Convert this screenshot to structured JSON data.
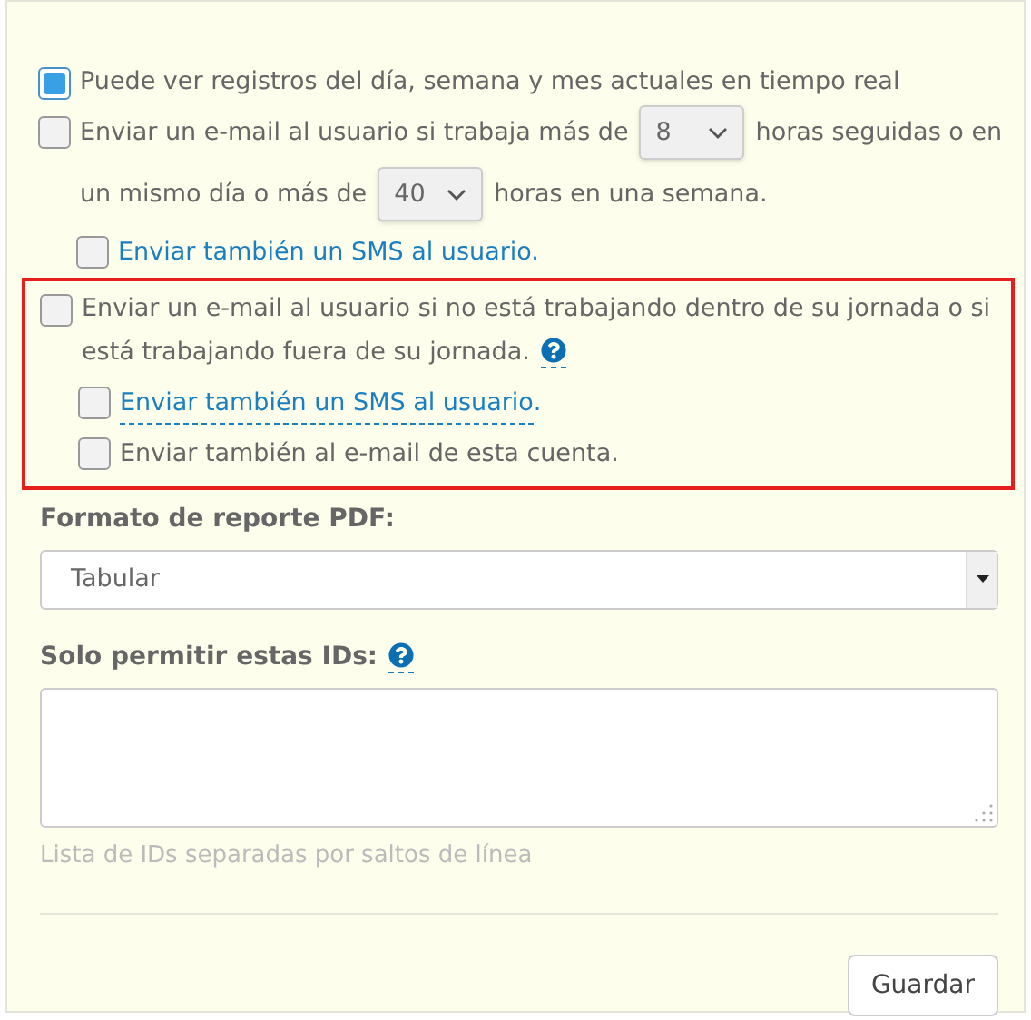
{
  "options": [
    {
      "kind": "plain",
      "checked": true,
      "label": "Puede ver registros del día, semana y mes actuales en tiempo real"
    },
    {
      "kind": "hours",
      "checked": false,
      "lines": [
        [
          {
            "kind": "text",
            "text": "Enviar un e-mail al usuario si trabaja más de"
          },
          {
            "kind": "select",
            "value": "8"
          },
          {
            "kind": "text",
            "text": "horas seguidas o en"
          }
        ],
        [
          {
            "kind": "text",
            "text": "un mismo día o más de"
          },
          {
            "kind": "select",
            "value": "40"
          },
          {
            "kind": "text",
            "text": "horas en una semana."
          }
        ]
      ],
      "sub_options": [
        {
          "kind": "link",
          "checked": false,
          "link": "Enviar también un SMS al usuario.",
          "underlined": false
        }
      ]
    },
    {
      "kind": "plain",
      "checked": false,
      "highlighted": true,
      "help": true,
      "label": "Enviar un e-mail al usuario si no está trabajando dentro de su jornada o si está trabajando fuera de su jornada.",
      "sub_options": [
        {
          "kind": "link",
          "checked": false,
          "link": "Enviar también un SMS al usuario",
          "suffix": ".",
          "underlined": true
        },
        {
          "kind": "plain",
          "checked": false,
          "label": "Enviar también al e-mail de esta cuenta."
        }
      ]
    }
  ],
  "pdf_format": {
    "label": "Formato de reporte PDF:",
    "value": "Tabular"
  },
  "ids": {
    "label": "Solo permitir estas IDs:",
    "help": true,
    "hint": "Lista de IDs separadas por saltos de línea"
  },
  "save_button": "Guardar"
}
